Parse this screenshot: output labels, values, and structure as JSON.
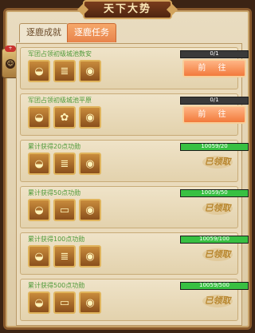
{
  "window": {
    "title": "天下大势"
  },
  "tabs": [
    {
      "label": "逐鹿成就",
      "active": false
    },
    {
      "label": "逐鹿任务",
      "active": true
    }
  ],
  "side_button": {
    "badge": "+"
  },
  "tasks": [
    {
      "title": "军团占领初级城池数安",
      "progress_text": "0/1",
      "progress": 0.0,
      "action": "前 往",
      "claimed": false,
      "rewards": [
        "gold-ingot-icon",
        "scroll-icon",
        "coin-pouch-icon"
      ]
    },
    {
      "title": "军团占领初级城池平原",
      "progress_text": "0/1",
      "progress": 0.0,
      "action": "前 往",
      "claimed": false,
      "rewards": [
        "gold-ingot-icon",
        "food-icon",
        "coin-pouch-icon"
      ]
    },
    {
      "title": "累计获得20点功勋",
      "progress_text": "10059/20",
      "progress": 1.0,
      "action": "已领取",
      "claimed": true,
      "rewards": [
        "gold-ingot-icon",
        "scroll-icon",
        "coin-pouch-icon"
      ]
    },
    {
      "title": "累计获得50点功勋",
      "progress_text": "10059/50",
      "progress": 1.0,
      "action": "已领取",
      "claimed": true,
      "rewards": [
        "gold-ingot-icon",
        "gold-bar-icon",
        "coin-pouch-icon"
      ]
    },
    {
      "title": "累计获得100点功勋",
      "progress_text": "10059/100",
      "progress": 1.0,
      "action": "已领取",
      "claimed": true,
      "rewards": [
        "gold-ingot-icon",
        "scroll-icon",
        "coin-pouch-icon"
      ]
    },
    {
      "title": "累计获得500点功勋",
      "progress_text": "10059/500",
      "progress": 1.0,
      "action": "已领取",
      "claimed": true,
      "rewards": [
        "gold-ingot-icon",
        "gold-bar-icon",
        "coin-pouch-icon"
      ]
    }
  ],
  "colors": {
    "progress_fill": "#38c042",
    "button": "#f27a3c",
    "title_text": "#4f9a3a"
  }
}
